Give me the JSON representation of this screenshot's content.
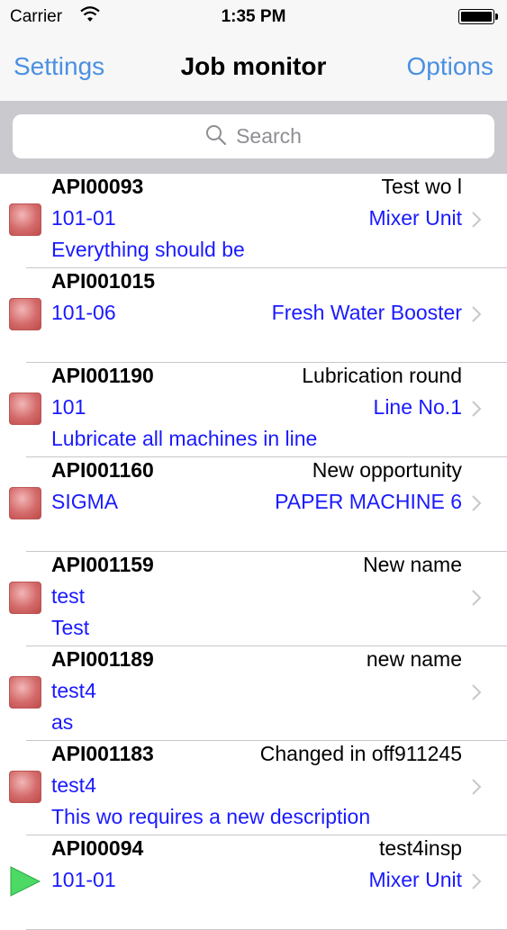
{
  "status_bar": {
    "carrier": "Carrier",
    "time": "1:35 PM"
  },
  "nav": {
    "left": "Settings",
    "title": "Job monitor",
    "right": "Options"
  },
  "search": {
    "placeholder": "Search"
  },
  "rows": [
    {
      "code": "API00093",
      "name": "Test wo l",
      "wo": "101-01",
      "equipment": "Mixer Unit",
      "description": "Everything should be",
      "status_icon": "red-square-icon"
    },
    {
      "code": "API001015",
      "name": "",
      "wo": "101-06",
      "equipment": "Fresh Water Booster",
      "description": "",
      "status_icon": "red-square-icon"
    },
    {
      "code": "API001190",
      "name": "Lubrication round",
      "wo": "101",
      "equipment": "Line No.1",
      "description": "Lubricate all machines in line",
      "status_icon": "red-square-icon"
    },
    {
      "code": "API001160",
      "name": "New opportunity",
      "wo": "SIGMA",
      "equipment": "PAPER MACHINE 6",
      "description": "",
      "status_icon": "red-square-icon"
    },
    {
      "code": "API001159",
      "name": "New name",
      "wo": "test",
      "equipment": "",
      "description": "Test",
      "status_icon": "red-square-icon"
    },
    {
      "code": "API001189",
      "name": "new name",
      "wo": "test4",
      "equipment": "",
      "description": "as",
      "status_icon": "red-square-icon"
    },
    {
      "code": "API001183",
      "name": "Changed in off911245",
      "wo": "test4",
      "equipment": "",
      "description": "This wo requires a new description",
      "status_icon": "red-square-icon"
    },
    {
      "code": "API00094",
      "name": "test4insp",
      "wo": "101-01",
      "equipment": "Mixer Unit",
      "description": "",
      "status_icon": "green-play-icon"
    }
  ]
}
